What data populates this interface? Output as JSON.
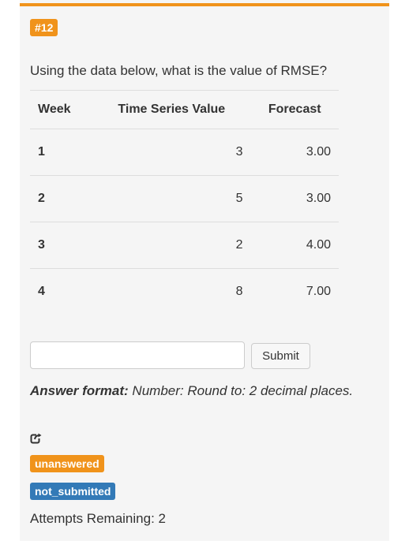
{
  "question": {
    "number": "#12",
    "text": "Using the data below, what is the value of RMSE?"
  },
  "table": {
    "headers": [
      "Week",
      "Time Series Value",
      "Forecast"
    ],
    "rows": [
      [
        "1",
        "3",
        "3.00"
      ],
      [
        "2",
        "5",
        "3.00"
      ],
      [
        "3",
        "2",
        "4.00"
      ],
      [
        "4",
        "8",
        "7.00"
      ]
    ]
  },
  "answer": {
    "input_value": "",
    "submit_label": "Submit",
    "format_label": "Answer format:",
    "format_text": "Number: Round to: 2 decimal places."
  },
  "status": {
    "share_icon": "share-icon",
    "state_badge": "unanswered",
    "submission_badge": "not_submitted",
    "attempts_text": "Attempts Remaining: 2"
  },
  "colors": {
    "accent_orange": "#f0931b",
    "badge_blue": "#337ab7"
  }
}
